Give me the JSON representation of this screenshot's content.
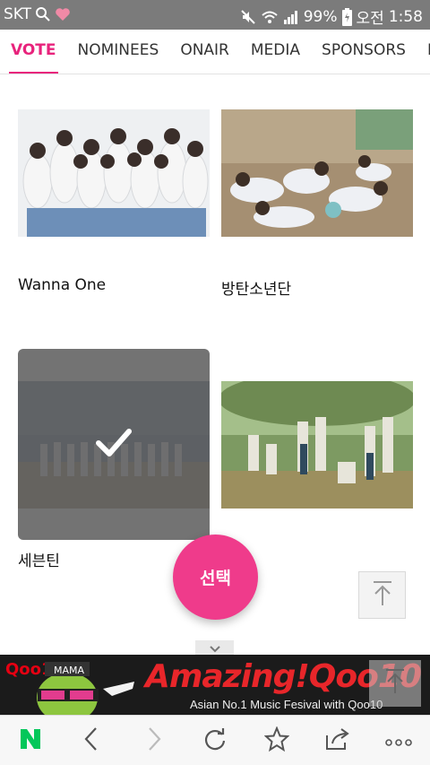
{
  "status_bar": {
    "carrier": "SKT",
    "battery_percent": "99%",
    "time_period": "오전",
    "time": "1:58"
  },
  "tabs": [
    {
      "label": "VOTE",
      "active": true
    },
    {
      "label": "NOMINEES",
      "active": false
    },
    {
      "label": "ONAIR",
      "active": false
    },
    {
      "label": "MEDIA",
      "active": false
    },
    {
      "label": "SPONSORS",
      "active": false
    },
    {
      "label": "HIS",
      "active": false
    }
  ],
  "nominees": [
    {
      "name": "Wanna One",
      "selected": false
    },
    {
      "name": "방탄소년단",
      "selected": false
    },
    {
      "name": "세븐틴",
      "selected": true
    },
    {
      "name": "",
      "selected": false
    }
  ],
  "fab": {
    "label": "선택"
  },
  "ad": {
    "logo": "Qoo10",
    "headline": "Amazing!Qoo10",
    "subline": "Asian No.1 Music Fesival with Qoo10",
    "mascot_text": "MAMA"
  },
  "browser_bar": {
    "icons": [
      "naver-icon",
      "back-icon",
      "forward-icon",
      "refresh-icon",
      "bookmark-star-icon",
      "share-icon",
      "more-icon"
    ]
  },
  "colors": {
    "accent": "#e8237c",
    "fab": "#ef3b8b",
    "status_bar": "#7b7b7b",
    "naver_green": "#03c75a"
  }
}
